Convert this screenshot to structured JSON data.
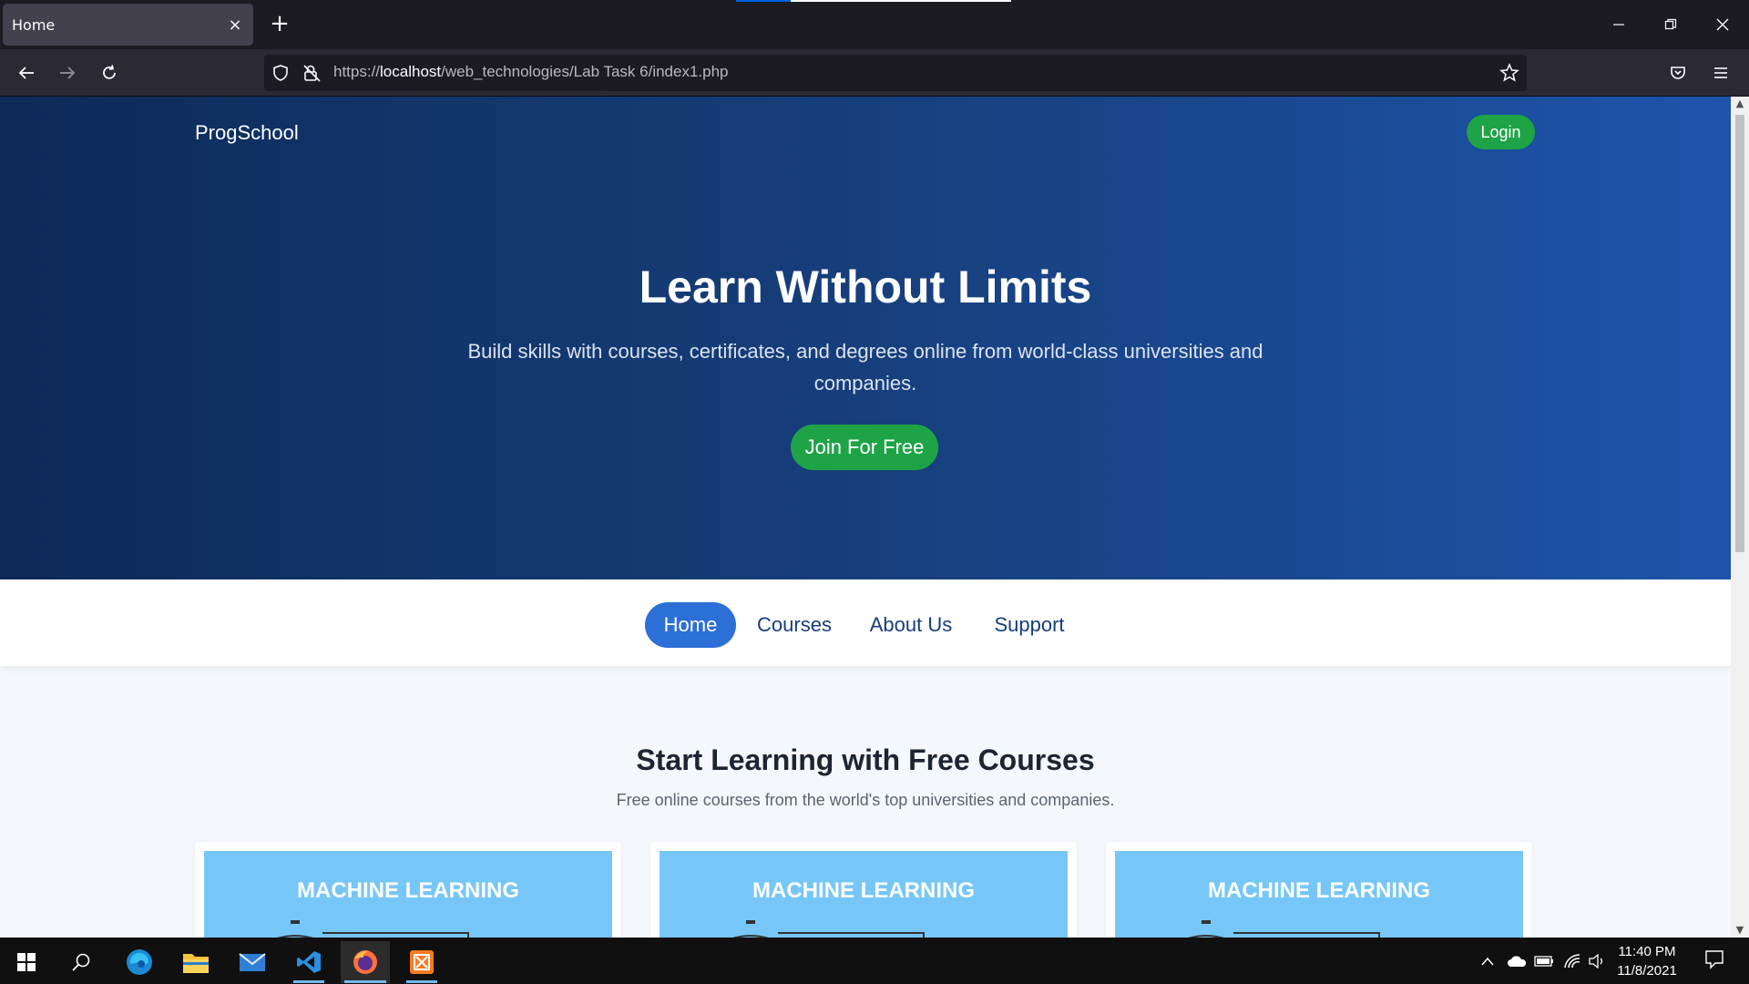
{
  "browser": {
    "tab_title": "Home",
    "tab_close": "×",
    "new_tab": "+",
    "url_prefix": "https://",
    "url_host": "localhost",
    "url_path": "/web_technologies/Lab Task 6/index1.php"
  },
  "page": {
    "brand": "ProgSchool",
    "login_label": "Login",
    "hero_title": "Learn Without Limits",
    "hero_subtitle": "Build skills with courses, certificates, and degrees online from world-class universities and companies.",
    "join_label": "Join For Free",
    "menu": [
      {
        "label": "Home",
        "active": true
      },
      {
        "label": "Courses",
        "active": false
      },
      {
        "label": "About Us",
        "active": false
      },
      {
        "label": "Support",
        "active": false
      }
    ],
    "section_title": "Start Learning with Free Courses",
    "section_subtitle": "Free online courses from the world's top universities and companies.",
    "cards": [
      {
        "image_title": "MACHINE LEARNING"
      },
      {
        "image_title": "MACHINE LEARNING"
      },
      {
        "image_title": "MACHINE LEARNING"
      }
    ]
  },
  "taskbar": {
    "time": "11:40 PM",
    "date": "11/8/2021"
  },
  "colors": {
    "hero_start": "#0d2a58",
    "hero_end": "#1d54aa",
    "green_button": "#1ea446",
    "active_menu": "#2c6fd6",
    "card_image": "#76c7f7"
  }
}
